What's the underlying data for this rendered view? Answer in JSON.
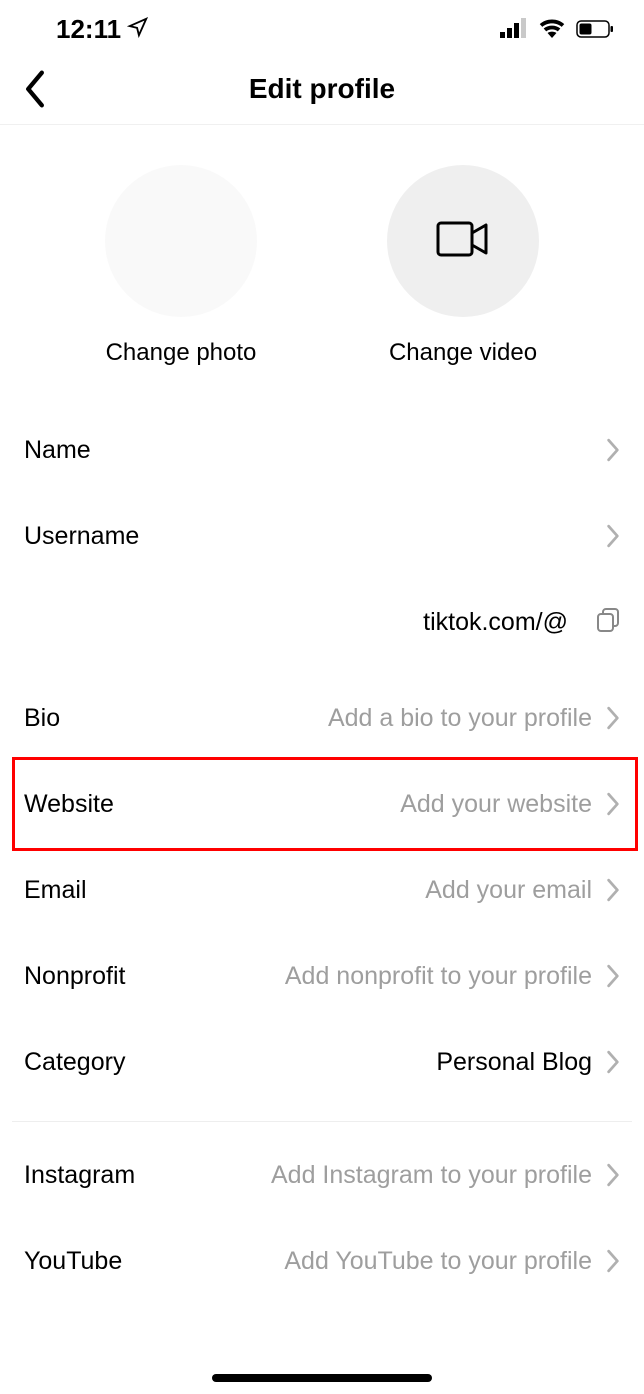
{
  "statusBar": {
    "time": "12:11"
  },
  "header": {
    "title": "Edit profile"
  },
  "media": {
    "photoLabel": "Change photo",
    "videoLabel": "Change video"
  },
  "url": {
    "text": "tiktok.com/@"
  },
  "rows": {
    "name": {
      "label": "Name",
      "value": ""
    },
    "username": {
      "label": "Username",
      "value": ""
    },
    "bio": {
      "label": "Bio",
      "placeholder": "Add a bio to your profile"
    },
    "website": {
      "label": "Website",
      "placeholder": "Add your website"
    },
    "email": {
      "label": "Email",
      "placeholder": "Add your email"
    },
    "nonprofit": {
      "label": "Nonprofit",
      "placeholder": "Add nonprofit to your profile"
    },
    "category": {
      "label": "Category",
      "value": "Personal Blog"
    },
    "instagram": {
      "label": "Instagram",
      "placeholder": "Add Instagram to your profile"
    },
    "youtube": {
      "label": "YouTube",
      "placeholder": "Add YouTube to your profile"
    }
  }
}
